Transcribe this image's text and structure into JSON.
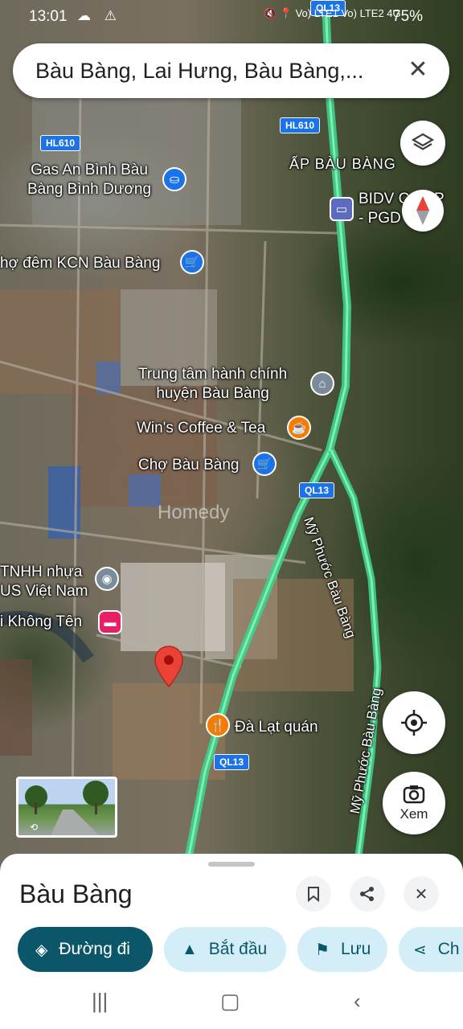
{
  "status_bar": {
    "time": "13:01",
    "left_icons": "☁ ⚠",
    "right_icons": "🔇 📍 Vo) LTE1 Vo) LTE2 4G",
    "battery": "75%"
  },
  "search": {
    "query": "Bàu Bàng, Lai Hưng, Bàu Bàng,...",
    "close_icon": "close-icon"
  },
  "map": {
    "labels": {
      "gas": "Gas An Bình Bàu\nBàng Bình Dương",
      "ap_bau_bang": "ẤP BÀU BÀNG",
      "bidv": "BIDV C   ỹ P\n- PGD   Bà",
      "cho_dem": "hợ đêm KCN Bàu Bàng",
      "trung_tam": "Trung tâm hành chính\nhuyện Bàu Bàng",
      "wins": "Win's Coffee & Tea",
      "cho_bau_bang": "Chợ Bàu Bàng",
      "tnhh": "TNHH nhựa\nUS Việt Nam",
      "khong_ten": "i Không Tên",
      "da_lat": "Đà Lạt quán",
      "my_phuoc_1": "Mỹ Phước Bàu Bàng",
      "my_phuoc_2": "Mỹ Phước Bàu Bàng",
      "watermark": "Homedy"
    },
    "road_shields": [
      "QL13",
      "HL610",
      "HL610",
      "QL13",
      "QL13"
    ],
    "poi_colors": {
      "shopping": "#1a73e8",
      "civic": "#5f6368",
      "food": "#f57c00",
      "hotel": "#e91e63",
      "generic": "#7a8c99"
    }
  },
  "street_view": {
    "icon": "rotate-360-icon"
  },
  "bottom_sheet": {
    "title": "Bàu Bàng",
    "buttons": {
      "save_icon": "bookmark-icon",
      "share_icon": "share-icon",
      "close_icon": "close-icon"
    },
    "chips": [
      {
        "label": "Đường đi",
        "icon": "directions-icon"
      },
      {
        "label": "Bắt đầu",
        "icon": "navigation-icon"
      },
      {
        "label": "Lưu",
        "icon": "bookmark-icon"
      },
      {
        "label": "Ch",
        "icon": "share-icon"
      }
    ]
  },
  "locate_button": {
    "icon": "my-location-icon"
  },
  "xem_button": {
    "label": "Xem",
    "icon": "lens-icon"
  },
  "accent_color": "#0b5769"
}
